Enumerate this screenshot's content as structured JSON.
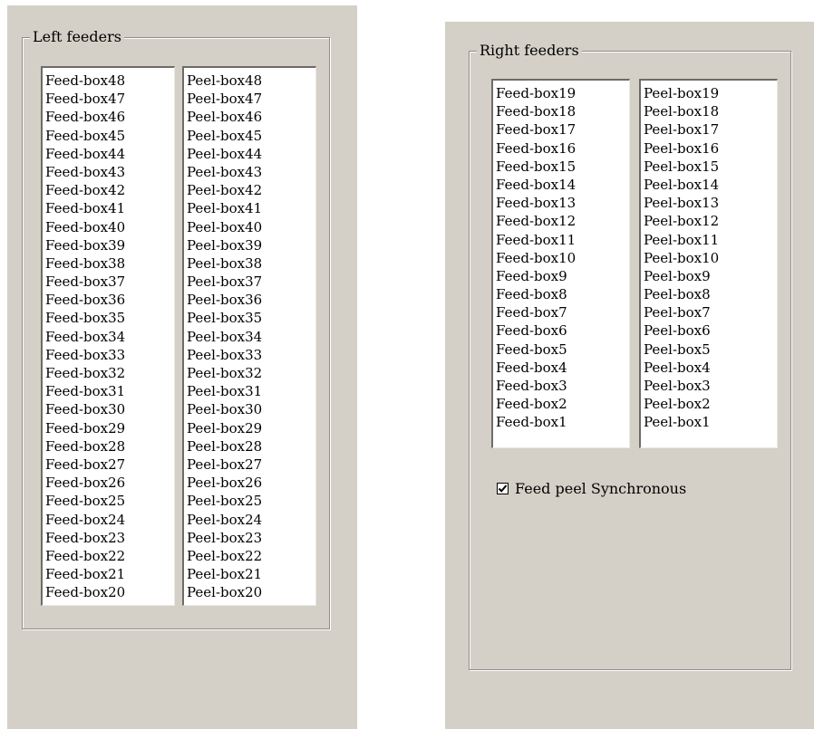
{
  "left_group": {
    "title": "Left feeders",
    "feed_items": [
      "Feed-box48",
      "Feed-box47",
      "Feed-box46",
      "Feed-box45",
      "Feed-box44",
      "Feed-box43",
      "Feed-box42",
      "Feed-box41",
      "Feed-box40",
      "Feed-box39",
      "Feed-box38",
      "Feed-box37",
      "Feed-box36",
      "Feed-box35",
      "Feed-box34",
      "Feed-box33",
      "Feed-box32",
      "Feed-box31",
      "Feed-box30",
      "Feed-box29",
      "Feed-box28",
      "Feed-box27",
      "Feed-box26",
      "Feed-box25",
      "Feed-box24",
      "Feed-box23",
      "Feed-box22",
      "Feed-box21",
      "Feed-box20"
    ],
    "peel_items": [
      "Peel-box48",
      "Peel-box47",
      "Peel-box46",
      "Peel-box45",
      "Peel-box44",
      "Peel-box43",
      "Peel-box42",
      "Peel-box41",
      "Peel-box40",
      "Peel-box39",
      "Peel-box38",
      "Peel-box37",
      "Peel-box36",
      "Peel-box35",
      "Peel-box34",
      "Peel-box33",
      "Peel-box32",
      "Peel-box31",
      "Peel-box30",
      "Peel-box29",
      "Peel-box28",
      "Peel-box27",
      "Peel-box26",
      "Peel-box25",
      "Peel-box24",
      "Peel-box23",
      "Peel-box22",
      "Peel-box21",
      "Peel-box20"
    ]
  },
  "right_group": {
    "title": "Right feeders",
    "feed_items": [
      "Feed-box19",
      "Feed-box18",
      "Feed-box17",
      "Feed-box16",
      "Feed-box15",
      "Feed-box14",
      "Feed-box13",
      "Feed-box12",
      "Feed-box11",
      "Feed-box10",
      "Feed-box9",
      "Feed-box8",
      "Feed-box7",
      "Feed-box6",
      "Feed-box5",
      "Feed-box4",
      "Feed-box3",
      "Feed-box2",
      "Feed-box1"
    ],
    "peel_items": [
      "Peel-box19",
      "Peel-box18",
      "Peel-box17",
      "Peel-box16",
      "Peel-box15",
      "Peel-box14",
      "Peel-box13",
      "Peel-box12",
      "Peel-box11",
      "Peel-box10",
      "Peel-box9",
      "Peel-box8",
      "Peel-box7",
      "Peel-box6",
      "Peel-box5",
      "Peel-box4",
      "Peel-box3",
      "Peel-box2",
      "Peel-box1"
    ],
    "sync_checkbox": {
      "label": "Feed peel Synchronous",
      "checked": true
    }
  }
}
